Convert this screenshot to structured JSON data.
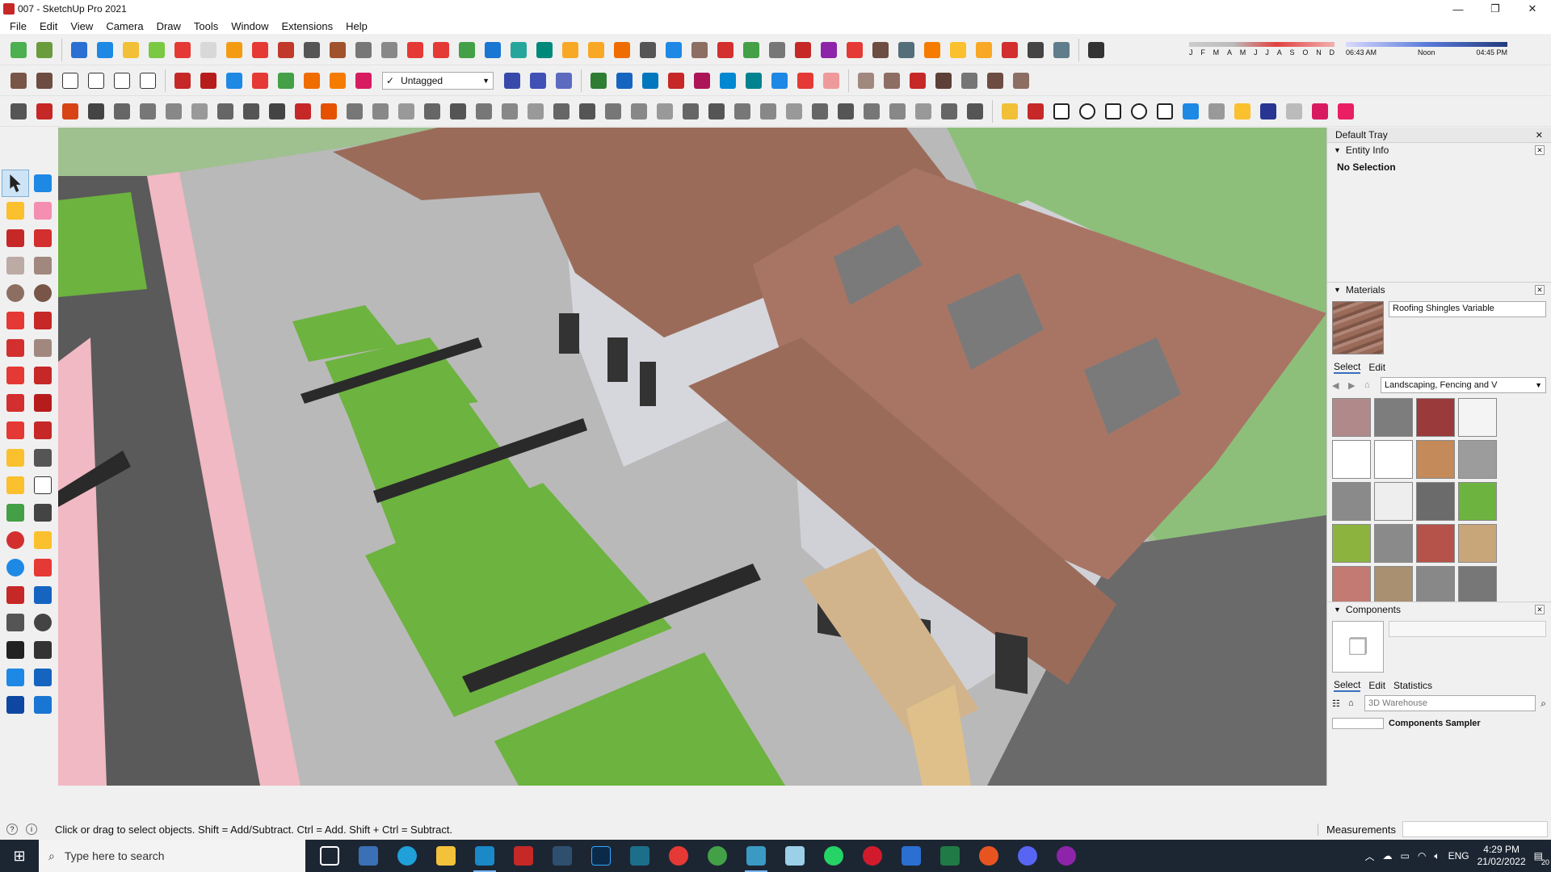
{
  "window": {
    "title": "007 - SketchUp Pro 2021",
    "controls": [
      "—",
      "❐",
      "✕"
    ]
  },
  "menu": [
    "File",
    "Edit",
    "View",
    "Camera",
    "Draw",
    "Tools",
    "Window",
    "Extensions",
    "Help"
  ],
  "toolbar": {
    "tag_selector": {
      "check": "✓",
      "value": "Untagged"
    },
    "shadow_months": [
      "J",
      "F",
      "M",
      "A",
      "M",
      "J",
      "J",
      "A",
      "S",
      "O",
      "N",
      "D"
    ],
    "shadow_time_start": "06:43 AM",
    "shadow_time_mid": "Noon",
    "shadow_time_end": "04:45 PM"
  },
  "tray": {
    "title": "Default Tray",
    "entity_info": {
      "title": "Entity Info",
      "body": "No Selection"
    },
    "materials": {
      "title": "Materials",
      "current_name": "Roofing Shingles Variable",
      "tabs": [
        "Select",
        "Edit"
      ],
      "library": "Landscaping, Fencing and V"
    },
    "components": {
      "title": "Components",
      "tabs": [
        "Select",
        "Edit",
        "Statistics"
      ],
      "search_placeholder": "3D Warehouse",
      "sampler_label": "Components Sampler"
    }
  },
  "status": {
    "hint": "Click or drag to select objects. Shift = Add/Subtract. Ctrl = Add. Shift + Ctrl = Subtract.",
    "measurements_label": "Measurements"
  },
  "taskbar": {
    "search_placeholder": "Type here to search",
    "language": "ENG",
    "time": "4:29 PM",
    "date": "21/02/2022",
    "notification_count": "20"
  },
  "colors": {
    "accent": "#3870c0",
    "taskbar_bg": "#1c2633",
    "lawn": "#6db33f",
    "roof": "#9b6b5a",
    "walkway": "#f1b9c3"
  }
}
